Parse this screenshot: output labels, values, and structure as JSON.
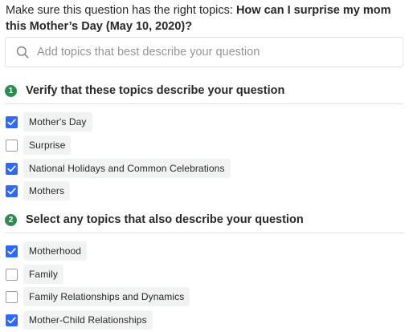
{
  "intro": {
    "prefix": "Make sure this question has the right topics: ",
    "question": "How can I surprise my mom this Mother’s Day (May 10, 2020)?"
  },
  "search": {
    "placeholder": "Add topics that best describe your question",
    "icon": "search-icon",
    "value": ""
  },
  "colors": {
    "checked": "#2e69ff",
    "step_badge": "#2e8b4f",
    "chip_bg": "#f1f2f2"
  },
  "sections": [
    {
      "number": "1",
      "title": "Verify that these topics describe your question",
      "topics": [
        {
          "label": "Mother's Day",
          "checked": true
        },
        {
          "label": "Surprise",
          "checked": false
        },
        {
          "label": "National Holidays and Common Celebrations",
          "checked": true
        },
        {
          "label": "Mothers",
          "checked": true
        }
      ]
    },
    {
      "number": "2",
      "title": "Select any topics that also describe your question",
      "topics": [
        {
          "label": "Motherhood",
          "checked": true
        },
        {
          "label": "Family",
          "checked": false
        },
        {
          "label": "Family Relationships and Dynamics",
          "checked": false
        },
        {
          "label": "Mother-Child Relationships",
          "checked": true
        }
      ]
    }
  ]
}
